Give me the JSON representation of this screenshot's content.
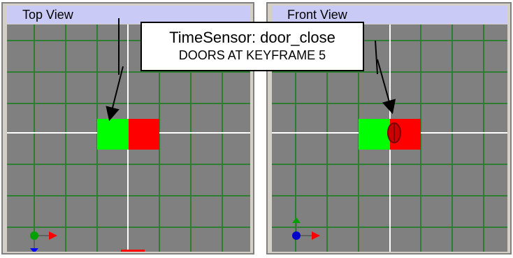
{
  "viewports": [
    {
      "title": "Top View"
    },
    {
      "title": "Front View"
    }
  ],
  "callout": {
    "line1": "TimeSensor: door_close",
    "line2": "DOORS AT KEYFRAME 5"
  },
  "colors": {
    "grid_background": "#808080",
    "grid_lines": "#2e7d32",
    "axis_lines": "#ffffff",
    "door_green": "#00ff00",
    "door_red": "#ff0000",
    "title_bar": "#cacaf6",
    "axis_x": "#ff0000",
    "axis_y": "#00a000",
    "axis_z": "#0000ff"
  },
  "icons": [
    "axis-gizmo-icon",
    "arrow-icon"
  ]
}
